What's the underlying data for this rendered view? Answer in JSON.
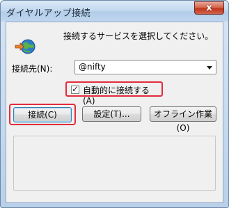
{
  "window": {
    "title": "ダイヤルアップ接続",
    "close_glyph": "x"
  },
  "dialog": {
    "icon": "dialup-connection-icon",
    "instruction": "接続するサービスを選択してください。",
    "connection_label": "接続先(N):",
    "connection_value": "@nifty",
    "auto_connect_label": "自動的に接続する(A)",
    "auto_connect_checked": true
  },
  "buttons": {
    "connect": "接続(C)",
    "settings": "設定(T)...",
    "offline": "オフライン作業(O)"
  },
  "colors": {
    "highlight_red": "#e32b3b",
    "close_button": "#c1361b",
    "titlebar": "#c4d9ef"
  }
}
